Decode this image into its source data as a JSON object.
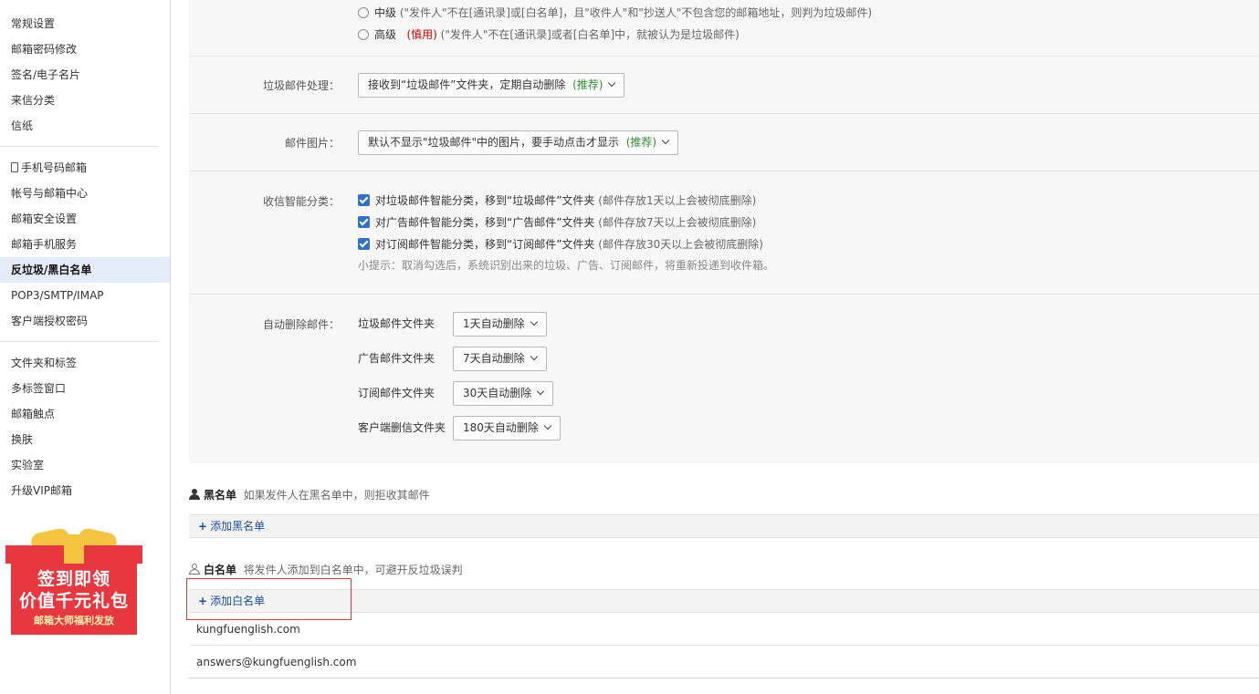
{
  "sidebar": {
    "groups": [
      [
        {
          "label": "常规设置"
        },
        {
          "label": "邮箱密码修改"
        },
        {
          "label": "签名/电子名片"
        },
        {
          "label": "来信分类"
        },
        {
          "label": "信纸"
        }
      ],
      [
        {
          "label": "手机号码邮箱"
        },
        {
          "label": "帐号与邮箱中心"
        },
        {
          "label": "邮箱安全设置"
        },
        {
          "label": "邮箱手机服务"
        },
        {
          "label": "反垃圾/黑白名单"
        },
        {
          "label": "POP3/SMTP/IMAP"
        },
        {
          "label": "客户端授权密码"
        }
      ],
      [
        {
          "label": "文件夹和标签"
        },
        {
          "label": "多标签窗口"
        },
        {
          "label": "邮箱触点"
        },
        {
          "label": "换肤"
        },
        {
          "label": "实验室"
        },
        {
          "label": "升级VIP邮箱"
        }
      ]
    ],
    "active": "反垃圾/黑白名单",
    "promo": {
      "line1": "签到即领",
      "line2": "价值千元礼包",
      "line3": "邮箱大师福利发放"
    }
  },
  "spam_level": {
    "options": [
      {
        "name": "中级",
        "tag": "",
        "desc": "(\"发件人\"不在[通讯录]或[白名单]，且\"收件人\"和\"抄送人\"不包含您的邮箱地址，则判为垃圾邮件)"
      },
      {
        "name": "高级",
        "tag": "(慎用)",
        "desc": "(\"发件人\"不在[通讯录]或者[白名单]中，就被认为是垃圾邮件)"
      }
    ]
  },
  "spam_handling": {
    "label": "垃圾邮件处理：",
    "value": "接收到“垃圾邮件”文件夹，定期自动删除",
    "badge": "(推荐)"
  },
  "images": {
    "label": "邮件图片：",
    "value": "默认不显示\"垃圾邮件\"中的图片，要手动点击才显示",
    "badge": "(推荐)"
  },
  "smart_sort": {
    "label": "收信智能分类：",
    "items": [
      {
        "text": "对垃圾邮件智能分类，移到“垃圾邮件”文件夹",
        "note": "(邮件存放1天以上会被彻底删除)"
      },
      {
        "text": "对广告邮件智能分类，移到“广告邮件”文件夹",
        "note": "(邮件存放7天以上会被彻底删除)"
      },
      {
        "text": "对订阅邮件智能分类，移到“订阅邮件”文件夹",
        "note": "(邮件存放30天以上会被彻底删除)"
      }
    ],
    "tip": "小提示：取消勾选后，系统识别出来的垃圾、广告、订阅邮件，将重新投递到收件箱。"
  },
  "auto_delete": {
    "label": "自动删除邮件：",
    "items": [
      {
        "folder": "垃圾邮件文件夹",
        "value": "1天自动删除"
      },
      {
        "folder": "广告邮件文件夹",
        "value": "7天自动删除"
      },
      {
        "folder": "订阅邮件文件夹",
        "value": "30天自动删除"
      },
      {
        "folder": "客户端删信文件夹",
        "value": "180天自动删除"
      }
    ]
  },
  "blacklist": {
    "title": "黑名单",
    "desc": "如果发件人在黑名单中，则拒收其邮件",
    "add_label": "添加黑名单"
  },
  "whitelist": {
    "title": "白名单",
    "desc": "将发件人添加到白名单中，可避开反垃圾误判",
    "add_label": "添加白名单",
    "entries": [
      "kungfuenglish.com",
      "answers@kungfuenglish.com"
    ]
  }
}
